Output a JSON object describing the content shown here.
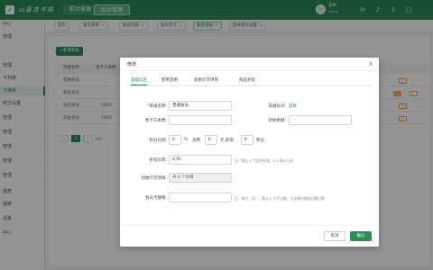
{
  "app": {
    "logo_text": "山喜吉卡邦",
    "front_label": "前台收银",
    "back_label": "后台管理",
    "user_name": "宜中",
    "user_sub": "admin",
    "icons": [
      "refresh-icon",
      "bell-icon",
      "download-icon",
      "fullscreen-icon"
    ]
  },
  "sidebar": {
    "items": [
      {
        "label": "中心"
      },
      {
        "label": "管理"
      },
      {
        "label": "管理"
      },
      {
        "label": "卡列表"
      },
      {
        "label": "卡等级"
      },
      {
        "label": "积分设置"
      },
      {
        "label": "管理"
      },
      {
        "label": "管理"
      },
      {
        "label": "管理"
      },
      {
        "label": "管理"
      },
      {
        "label": "管理"
      },
      {
        "label": "报表"
      },
      {
        "label": "报表"
      },
      {
        "label": "设置"
      },
      {
        "label": "中心"
      }
    ]
  },
  "tabs": [
    {
      "label": "首页"
    },
    {
      "label": "会员清单"
    },
    {
      "label": "会员列表"
    },
    {
      "label": "会员开卡"
    },
    {
      "label": "会员等级"
    },
    {
      "label": "基本积分设置"
    }
  ],
  "content": {
    "add_button": "+新增等级",
    "table_headers": [
      "等级名称",
      "等卡工本费"
    ],
    "rows": [
      {
        "name": "普通会员",
        "fee": ""
      },
      {
        "name": "黄金会员",
        "fee": ""
      },
      {
        "name": "钻石会员",
        "fee": "1000"
      },
      {
        "name": "白金会员",
        "fee": "1000"
      }
    ],
    "pager": {
      "current": "1",
      "total_label": "100"
    }
  },
  "modal": {
    "title": "修改",
    "close": "×",
    "tabs": [
      "基础信息",
      "使用说明",
      "初始计次项目",
      "商品折扣"
    ],
    "fields": {
      "level_name_label": "等级名称:",
      "level_name_value": "普通会员",
      "level_mark_label": "等级标识:",
      "level_mark_value": "选择",
      "card_fee_label": "售卡工本费:",
      "card_fee_value": "",
      "initial_amount_label": "初始余额:",
      "initial_amount_value": "",
      "points_ratio_label": "积分比例:",
      "points_ratio_value": "0",
      "points_unit": "%",
      "consume_label": "消费",
      "consume_value": "0",
      "consume_unit": "元,获得",
      "get_points_value": "0",
      "points_word": "积分",
      "discount_label": "折扣比率:",
      "discount_value": "0.95",
      "discount_hint": "注：默认 1 为没有折扣，0.9 表示九折",
      "count_items_label": "初始计次项目:",
      "count_items_value": "共 0 个项目",
      "valid_label": "会员卡期限:",
      "valid_value": "",
      "valid_hint": "注：单位（天），默认 0 为不过期，可选择过期或过期日期"
    },
    "cancel_label": "取消",
    "ok_label": "确认"
  }
}
